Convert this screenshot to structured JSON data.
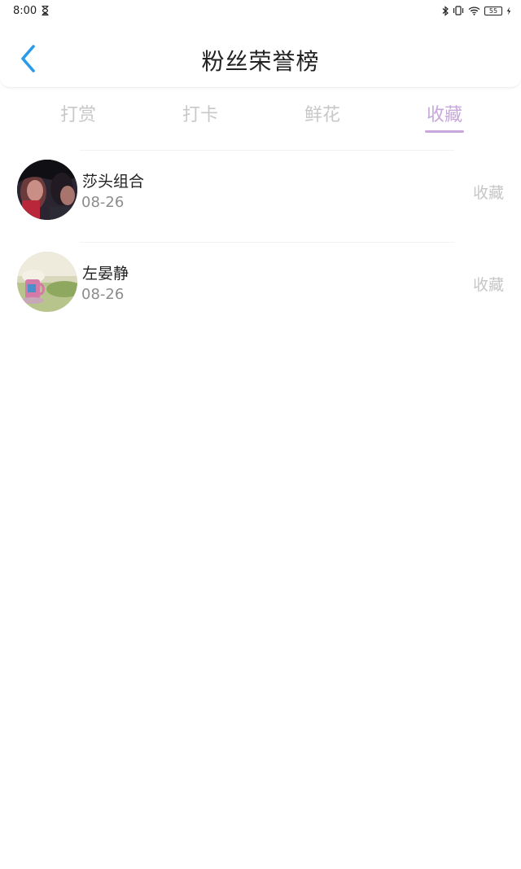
{
  "status_bar": {
    "time": "8:00",
    "battery": "55",
    "icons": [
      "hourglass-icon",
      "bluetooth-icon",
      "vibrate-icon",
      "wifi-icon",
      "battery-icon",
      "charging-icon"
    ]
  },
  "header": {
    "back_icon": "chevron-left-icon",
    "title": "粉丝荣誉榜"
  },
  "tabs": [
    {
      "label": "打赏",
      "active": false
    },
    {
      "label": "打卡",
      "active": false
    },
    {
      "label": "鲜花",
      "active": false
    },
    {
      "label": "收藏",
      "active": true
    }
  ],
  "colors": {
    "accent": "#c7a8dc",
    "back_icon": "#2a9be8",
    "inactive_tab": "#c8c8c8"
  },
  "list": [
    {
      "name": "莎头组合",
      "date": "08-26",
      "action": "收藏"
    },
    {
      "name": "左晏静",
      "date": "08-26",
      "action": "收藏"
    }
  ]
}
